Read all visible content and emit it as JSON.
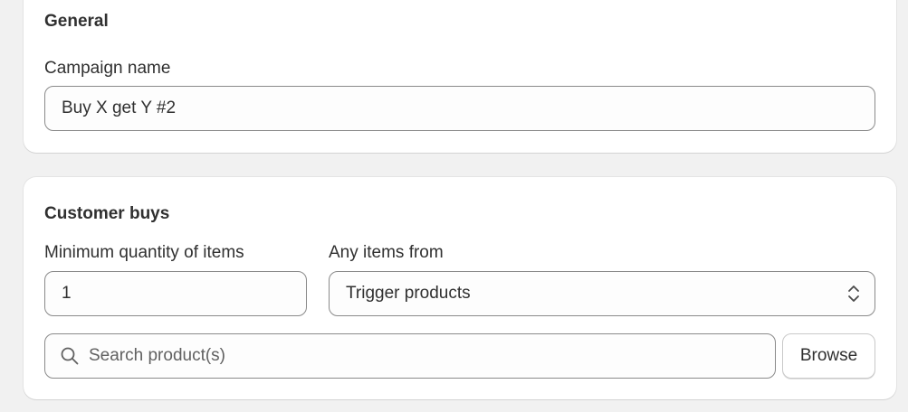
{
  "general": {
    "title": "General",
    "campaign_name_label": "Campaign name",
    "campaign_name_value": "Buy X get Y #2"
  },
  "customer_buys": {
    "title": "Customer buys",
    "min_quantity_label": "Minimum quantity of items",
    "min_quantity_value": "1",
    "any_items_label": "Any items from",
    "any_items_selected": "Trigger products",
    "search_placeholder": "Search product(s)",
    "browse_label": "Browse"
  },
  "icons": {
    "search": "search-icon",
    "select": "chevron-up-down-icon"
  },
  "colors": {
    "background": "#f1f1f1",
    "card": "#ffffff",
    "text": "#303030",
    "border": "#8a8a8a",
    "placeholder": "#616161"
  }
}
